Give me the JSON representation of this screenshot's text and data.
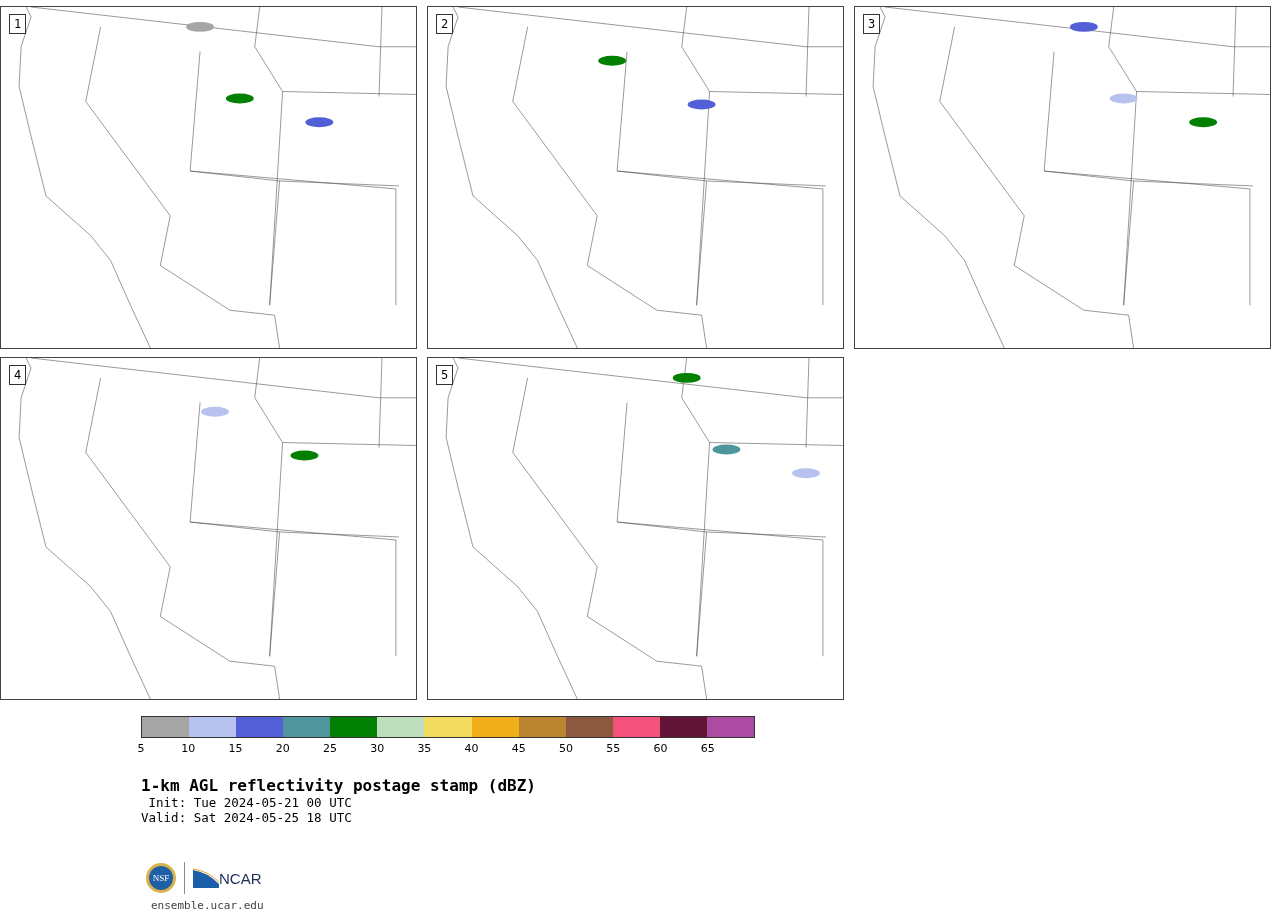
{
  "panels": [
    {
      "label": "1"
    },
    {
      "label": "2"
    },
    {
      "label": "3"
    },
    {
      "label": "4"
    },
    {
      "label": "5"
    }
  ],
  "colorbar": {
    "segments": [
      {
        "color": "#a5a5a5"
      },
      {
        "color": "#b7c3ee"
      },
      {
        "color": "#525fd6"
      },
      {
        "color": "#4f959c"
      },
      {
        "color": "#028001"
      },
      {
        "color": "#bfdebd"
      },
      {
        "color": "#f1dc60"
      },
      {
        "color": "#f0ae1a"
      },
      {
        "color": "#bb8431"
      },
      {
        "color": "#8b5a3e"
      },
      {
        "color": "#f5517d"
      },
      {
        "color": "#611637"
      },
      {
        "color": "#ad4ba3"
      }
    ],
    "ticks": [
      "5",
      "10",
      "15",
      "20",
      "25",
      "30",
      "35",
      "40",
      "45",
      "50",
      "55",
      "60",
      "65"
    ]
  },
  "title": "1-km AGL reflectivity postage stamp (dBZ)",
  "init": " Init: Tue 2024-05-21 00 UTC",
  "valid": "Valid: Sat 2024-05-25 18 UTC",
  "logos": {
    "nsf": "NSF",
    "ncar": "NCAR"
  },
  "url": "ensemble.ucar.edu"
}
